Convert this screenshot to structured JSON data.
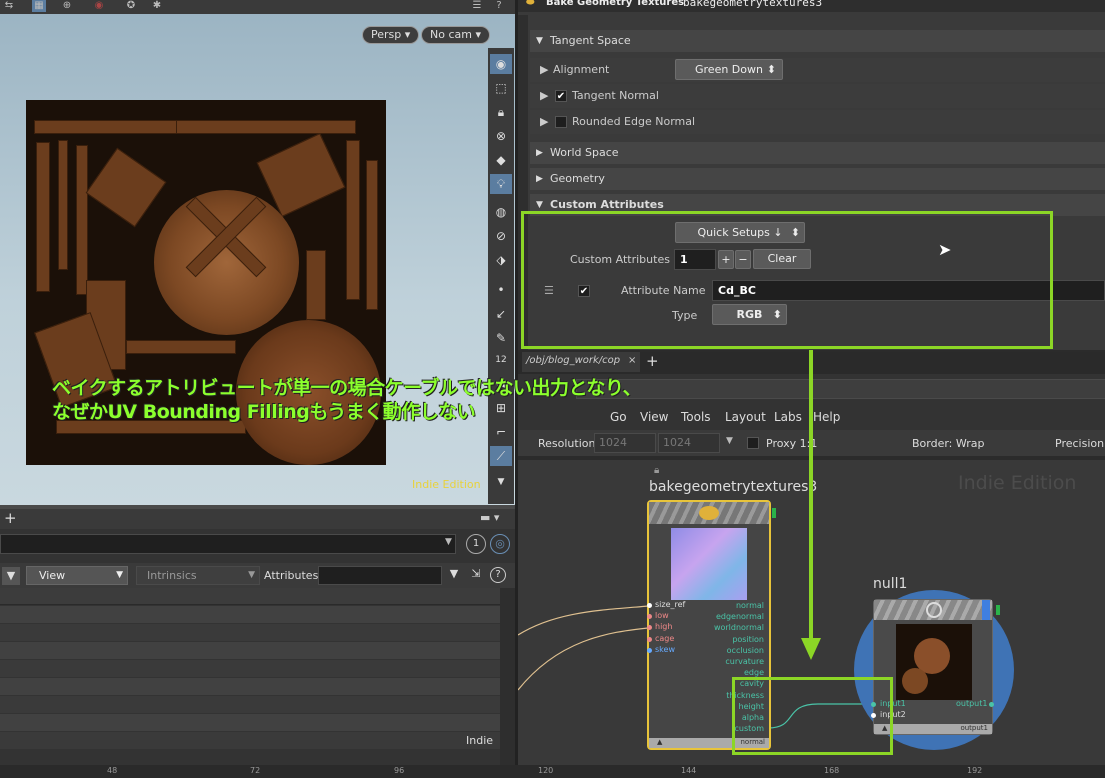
{
  "viewport": {
    "camera_menu": "Persp",
    "cam_menu": "No cam",
    "indie_label": "Indie Edition"
  },
  "bottom_left": {
    "view_menu": "View",
    "intrinsics_menu": "Intrinsics",
    "attributes_label": "Attributes:",
    "badge": "1",
    "indie_label": "Indie"
  },
  "params": {
    "header_type": "Bake Geometry Textures",
    "header_name": "bakegeometrytextures3",
    "tangent_space": "Tangent Space",
    "alignment_label": "Alignment",
    "alignment_value": "Green Down",
    "tangent_normal": "Tangent Normal",
    "rounded_edge_normal": "Rounded Edge Normal",
    "world_space": "World Space",
    "geometry": "Geometry",
    "custom_attributes_header": "Custom Attributes",
    "quick_setups": "Quick Setups ↓",
    "custom_attributes_label": "Custom Attributes",
    "custom_attributes_count": "1",
    "plus": "+",
    "minus": "−",
    "clear": "Clear",
    "attribute_name_label": "Attribute Name",
    "attribute_name_value": "Cd_BC",
    "type_label": "Type",
    "type_value": "RGB"
  },
  "network": {
    "tab_path": "/obj/blog_work/cop",
    "menu": [
      "Go",
      "View",
      "Tools",
      "Layout",
      "Labs",
      "Help"
    ],
    "resolution_label": "Resolution",
    "res_x": "1024",
    "res_y": "1024",
    "proxy": "Proxy 1:1",
    "border": "Border: Wrap",
    "precision": "Precision:",
    "indie": "Indie Edition",
    "node1_name": "bakegeometrytextures3",
    "node1_inputs": [
      "size_ref",
      "low",
      "high",
      "cage",
      "skew"
    ],
    "node1_outputs": [
      "normal",
      "edgenormal",
      "worldnormal",
      "position",
      "occlusion",
      "curvature",
      "edge",
      "cavity",
      "thickness",
      "height",
      "alpha",
      "custom"
    ],
    "node1_footer": "normal",
    "node2_name": "null1",
    "node2_inputs": [
      "input1",
      "input2"
    ],
    "node2_output": "output1",
    "node2_footer": "output1"
  },
  "annotation": {
    "line1": "ベイクするアトリビュートが単一の場合ケーブルではない出力となり、",
    "line2": "なぜかUV Bounding Fillingもうまく動作しない"
  },
  "ruler": [
    "48",
    "72",
    "96",
    "120",
    "144",
    "168",
    "192"
  ],
  "colors": {
    "highlight": "#8cd626",
    "node_selected": "#e8c43a",
    "null_node": "#3f73b5"
  }
}
